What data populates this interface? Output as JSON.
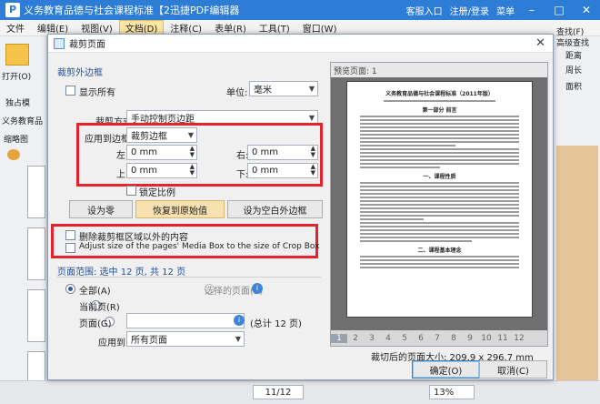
{
  "app": {
    "title": "义务教育品德与社会课程标准【2迅捷PDF编辑器",
    "customer_service": "客服入口",
    "login": "注册/登录",
    "menu": "菜单",
    "logo_letter": "P"
  },
  "menubar": [
    "文件",
    "编辑(E)",
    "视图(V)",
    "文档(D)",
    "注释(C)",
    "表单(R)",
    "工具(T)",
    "窗口(W)"
  ],
  "left_panel": {
    "open": "打开(O)",
    "thumbs_title": "独占模",
    "doc_tab": "义务教育品",
    "thumbnail": "缩略图"
  },
  "right_panel": {
    "search": "查找(F)",
    "advanced_search": "高级查找",
    "distance": "距离",
    "perimeter": "周长",
    "area": "面积"
  },
  "dialog": {
    "title": "裁剪页面",
    "margins_section": "裁剪外边框",
    "show_all": "显示所有",
    "unit_label": "单位:",
    "unit_value": "毫米",
    "crop_mode_label": "裁剪方式",
    "crop_mode_value": "手动控制页边距",
    "apply_to_label": "应用到边框",
    "apply_to_value": "裁剪边框",
    "left_label": "左:",
    "left_value": "0 mm",
    "right_label": "右:",
    "right_value": "0 mm",
    "top_label": "上:",
    "top_value": "0 mm",
    "bottom_label": "下:",
    "bottom_value": "0 mm",
    "lock_ratio": "锁定比例",
    "set_zero": "设为零",
    "restore": "恢复到原始值",
    "set_blank": "设为空白外边框",
    "delete_outside": "删除裁剪框区域以外的内容",
    "adjust_media": "Adjust size of the pages' Media Box to the size of Crop Box",
    "range_title": "页面范围: 选中 12 页, 共 12 页",
    "all": "全部(A)",
    "selected_pages": "选择的页面(S)",
    "current_page": "当前页(R)",
    "pages": "页面(G)",
    "total": "(总计 12 页)",
    "apply_label": "应用到:",
    "apply_value": "所有页面",
    "preview_label": "预览页面: 1",
    "page_size": "裁切后的页面大小: 209.9 x 296.7 mm",
    "ok": "确定(O)",
    "cancel": "取消(C)",
    "page_numbers": [
      "1",
      "2",
      "3",
      "4",
      "5",
      "6",
      "7",
      "8",
      "9",
      "10",
      "11",
      "12"
    ]
  },
  "preview_doc": {
    "title": "义务教育品德与社会课程标准（2011年版）",
    "heading1": "第一部分 前言",
    "heading2": "一、课程性质",
    "heading3": "二、课程基本理念"
  },
  "statusbar": {
    "page": "11/12",
    "zoom": "13%"
  },
  "colors": {
    "titlebar": "#2d7cd6",
    "highlight": "#e5232d"
  }
}
